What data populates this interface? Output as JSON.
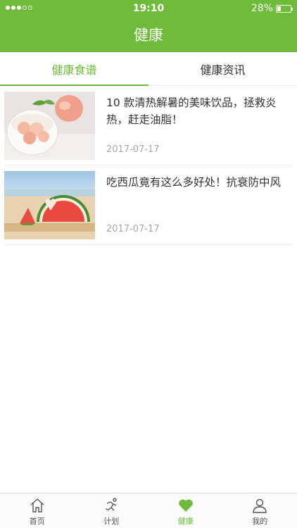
{
  "status_bar": {
    "time": "19:10",
    "battery": "28%",
    "battery_level": 0.28
  },
  "header": {
    "title": "健康"
  },
  "tabs": [
    {
      "label": "健康食谱",
      "active": true
    },
    {
      "label": "健康资讯",
      "active": false
    }
  ],
  "articles": [
    {
      "title": "10 款清热解暑的美味饮品，拯救炎热，赶走油脂！",
      "date": "2017-07-17",
      "image": "peach-drink-photo"
    },
    {
      "title": "吃西瓜竟有这么多好处！抗衰防中风",
      "date": "2017-07-17",
      "image": "watermelon-photo"
    }
  ],
  "tab_bar": [
    {
      "label": "首页",
      "icon": "home-icon"
    },
    {
      "label": "计划",
      "icon": "running-icon"
    },
    {
      "label": "健康",
      "icon": "heart-icon",
      "active": true
    },
    {
      "label": "我的",
      "icon": "person-icon"
    }
  ],
  "colors": {
    "brand": "#6dbb38"
  }
}
